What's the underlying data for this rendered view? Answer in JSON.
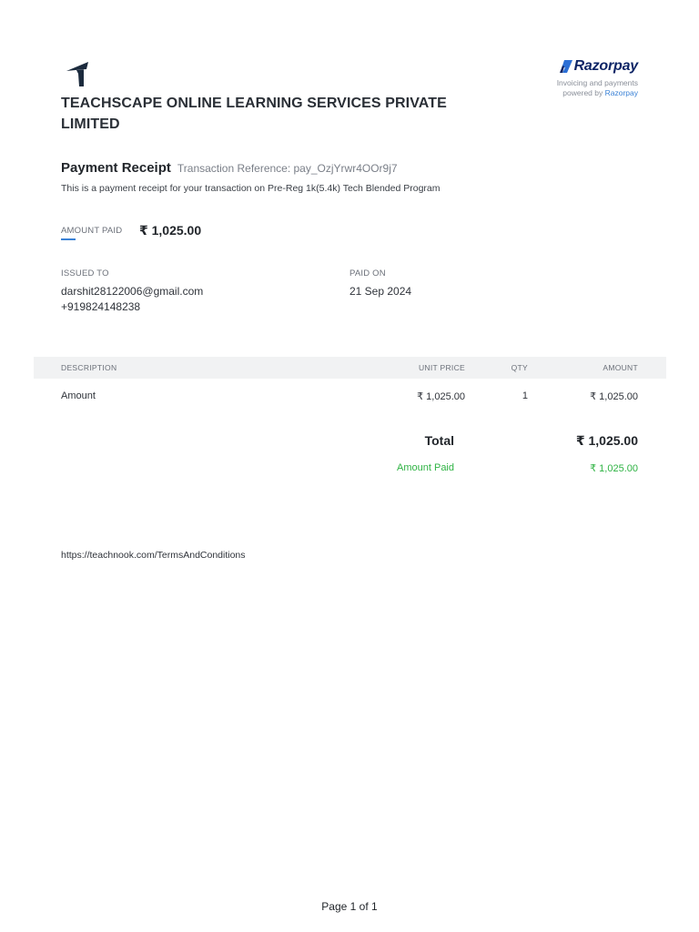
{
  "company": {
    "name": "TEACHSCAPE ONLINE LEARNING SERVICES PRIVATE LIMITED",
    "logo_icon": "teachnook-logo-icon"
  },
  "razorpay": {
    "brand": "Razorpay",
    "tagline_line1": "Invoicing and payments",
    "tagline_prefix": "powered by ",
    "tagline_link": "Razorpay",
    "brand_color": "#0d2566",
    "accent_color": "#3b82d6"
  },
  "receipt": {
    "title": "Payment Receipt",
    "transaction_reference": "Transaction Reference: pay_OzjYrwr4OOr9j7",
    "description": "This is a payment receipt for your transaction on Pre-Reg 1k(5.4k) Tech Blended Program"
  },
  "amount_paid": {
    "label": "AMOUNT PAID",
    "value": "₹ 1,025.00"
  },
  "issued_to": {
    "label": "ISSUED TO",
    "email": "darshit28122006@gmail.com",
    "phone": "+919824148238"
  },
  "paid_on": {
    "label": "PAID ON",
    "date": "21 Sep 2024"
  },
  "table": {
    "headers": {
      "description": "DESCRIPTION",
      "unit_price": "UNIT PRICE",
      "qty": "QTY",
      "amount": "AMOUNT"
    },
    "rows": [
      {
        "description": "Amount",
        "unit_price": "₹ 1,025.00",
        "qty": "1",
        "amount": "₹ 1,025.00"
      }
    ]
  },
  "totals": {
    "total_label": "Total",
    "total_value": "₹ 1,025.00",
    "paid_label": "Amount Paid",
    "paid_value": "₹ 1,025.00",
    "paid_color": "#2fb344"
  },
  "terms_url": "https://teachnook.com/TermsAndConditions",
  "footer": {
    "page": "Page 1 of 1"
  }
}
